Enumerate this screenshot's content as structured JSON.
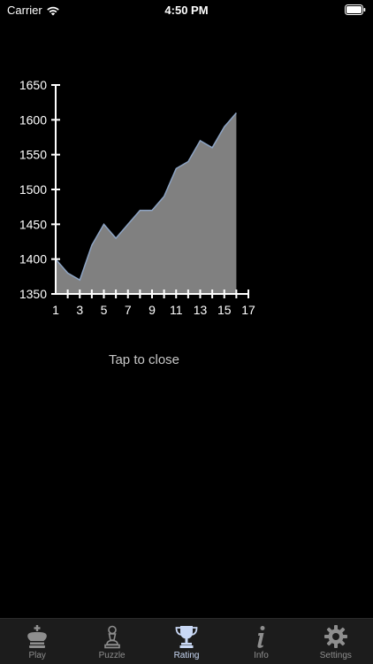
{
  "status_bar": {
    "carrier": "Carrier",
    "time": "4:50 PM"
  },
  "chart_data": {
    "type": "area",
    "x": [
      1,
      2,
      3,
      4,
      5,
      6,
      7,
      8,
      9,
      10,
      11,
      12,
      13,
      14,
      15,
      16
    ],
    "values": [
      1400,
      1380,
      1370,
      1420,
      1450,
      1430,
      1450,
      1470,
      1470,
      1490,
      1530,
      1540,
      1570,
      1560,
      1590,
      1610
    ],
    "xlim": [
      1,
      17
    ],
    "ylim": [
      1350,
      1650
    ],
    "x_ticks": [
      "1",
      "3",
      "5",
      "7",
      "9",
      "11",
      "13",
      "15",
      "17"
    ],
    "y_ticks": [
      "1350",
      "1400",
      "1450",
      "1500",
      "1550",
      "1600",
      "1650"
    ],
    "fill_color": "#808080",
    "line_color": "#8da4c4",
    "axis_color": "#ffffff",
    "grid": false
  },
  "close_text": "Tap to close",
  "tabs": [
    {
      "label": "Play",
      "icon": "king-icon",
      "active": false
    },
    {
      "label": "Puzzle",
      "icon": "pawn-icon",
      "active": false
    },
    {
      "label": "Rating",
      "icon": "trophy-icon",
      "active": true
    },
    {
      "label": "Info",
      "icon": "info-icon",
      "active": false
    },
    {
      "label": "Settings",
      "icon": "gear-icon",
      "active": false
    }
  ],
  "colors": {
    "active_tab": "#c9d8f5",
    "inactive_tab": "#8e8e8e",
    "tab_bar_bg": "#1c1c1c"
  }
}
